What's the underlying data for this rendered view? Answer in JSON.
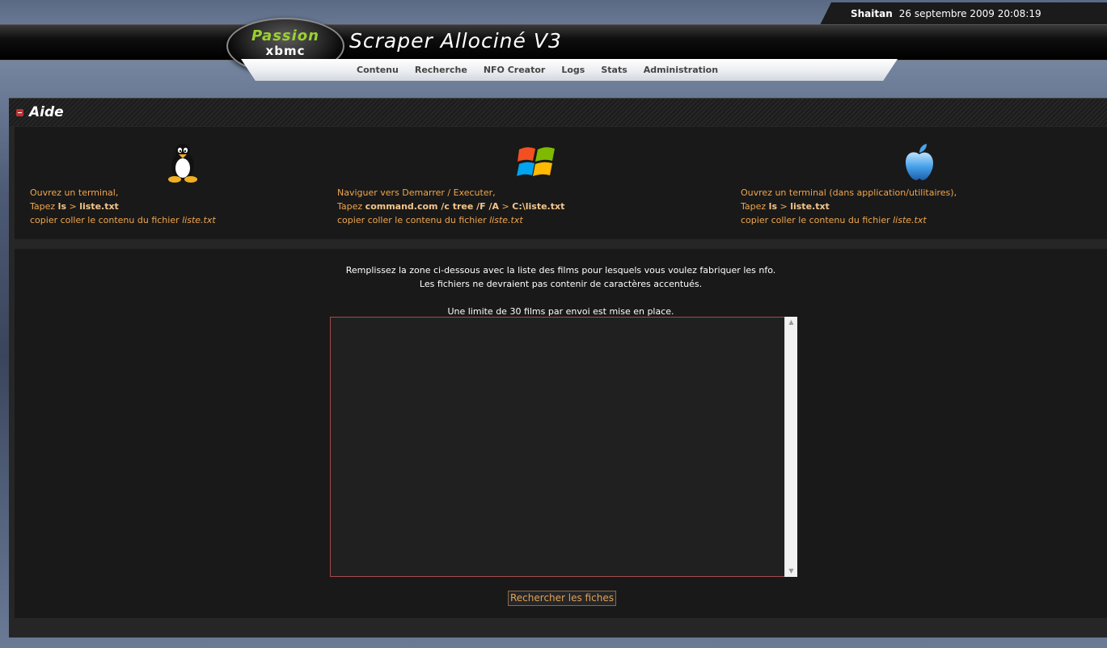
{
  "header": {
    "user": "Shaitan",
    "datetime": "26 septembre 2009 20:08:19",
    "title": "Scraper Allociné V3",
    "logo_top": "Passion",
    "logo_bottom": "xbmc"
  },
  "nav": {
    "items": [
      "Contenu",
      "Recherche",
      "NFO Creator",
      "Logs",
      "Stats",
      "Administration"
    ]
  },
  "aide": {
    "title": "Aide",
    "linux": {
      "line1": "Ouvrez un terminal,",
      "tapez": "Tapez",
      "cmd1": "ls",
      "gt": ">",
      "cmd2": "liste.txt",
      "line3": "copier coller le contenu du fichier",
      "file": "liste.txt"
    },
    "windows": {
      "line1": "Naviguer vers Demarrer / Executer,",
      "tapez": "Tapez",
      "cmd1": "command.com /c tree /F /A",
      "gt": ">",
      "cmd2": "C:\\liste.txt",
      "line3": "copier coller le contenu du fichier",
      "file": "liste.txt"
    },
    "mac": {
      "line1": "Ouvrez un terminal (dans application/utilitaires),",
      "tapez": "Tapez",
      "cmd1": "ls",
      "gt": ">",
      "cmd2": "liste.txt",
      "line3": "copier coller le contenu du fichier",
      "file": "liste.txt"
    }
  },
  "form": {
    "line1": "Remplissez la zone ci-dessous avec la liste des films pour lesquels vous voulez fabriquer les nfo.",
    "line2": "Les fichiers ne devraient pas contenir de caractères accentués.",
    "line3": "Une limite de 30 films par envoi est mise en place.",
    "textarea_value": "",
    "submit_label": "Rechercher les fiches"
  },
  "colors": {
    "accent_text": "#f0a64e",
    "logo_green": "#9bd12f",
    "textarea_border": "#a34a4a"
  }
}
